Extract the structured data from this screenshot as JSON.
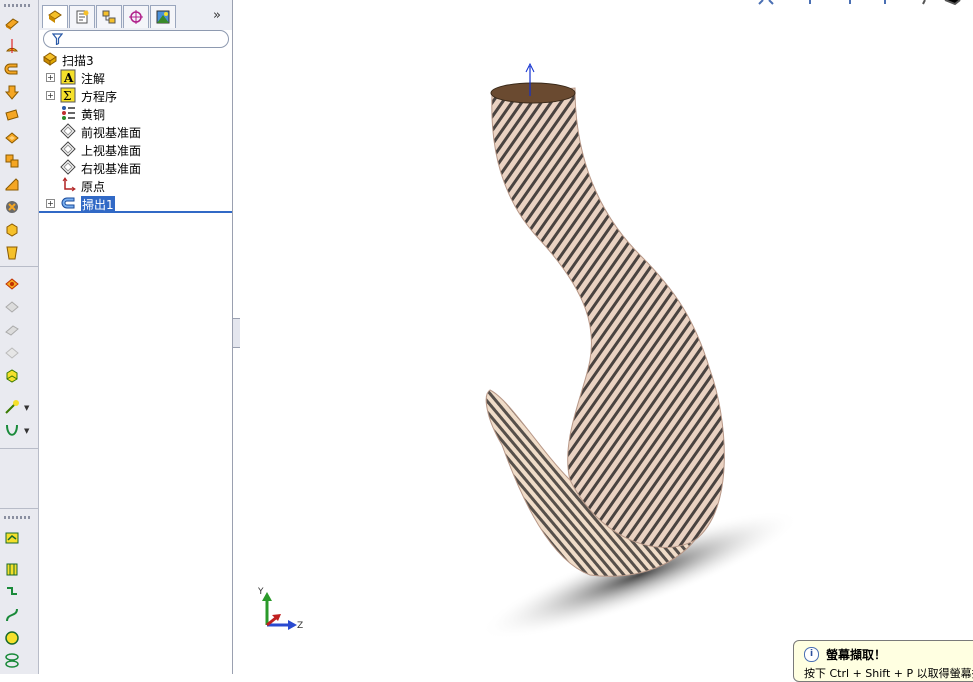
{
  "feature_tree": {
    "root": {
      "label": "扫描3",
      "icon": "part-icon"
    },
    "items": [
      {
        "label": "注解",
        "icon": "annotations-icon",
        "expandable": true,
        "selected": false
      },
      {
        "label": "方程序",
        "icon": "equations-icon",
        "expandable": true,
        "selected": false
      },
      {
        "label": "黄铜",
        "icon": "material-icon",
        "expandable": false,
        "selected": false
      },
      {
        "label": "前视基准面",
        "icon": "plane-icon",
        "expandable": false,
        "selected": false
      },
      {
        "label": "上视基准面",
        "icon": "plane-icon",
        "expandable": false,
        "selected": false
      },
      {
        "label": "右视基准面",
        "icon": "plane-icon",
        "expandable": false,
        "selected": false
      },
      {
        "label": "原点",
        "icon": "origin-icon",
        "expandable": false,
        "selected": false
      },
      {
        "label": "掃出1",
        "icon": "sweep-icon",
        "expandable": true,
        "selected": true
      }
    ],
    "tabs": [
      "featuremanager-tab",
      "propertymanager-tab",
      "configurationmanager-tab",
      "dimxpert-tab",
      "display-manager-tab"
    ],
    "more_tabs": "»",
    "expand_glyph": "+"
  },
  "view_triad": {
    "y_label": "Y",
    "z_label": "Z"
  },
  "tooltip": {
    "title": "螢幕擷取！",
    "body": "按下 Ctrl + Shift + P 以取得螢幕擷",
    "info_glyph": "i"
  },
  "colors": {
    "selection": "#3169c6",
    "hook_base": "#d8b8a8",
    "toolbar_bg": "#e9eaf0"
  }
}
